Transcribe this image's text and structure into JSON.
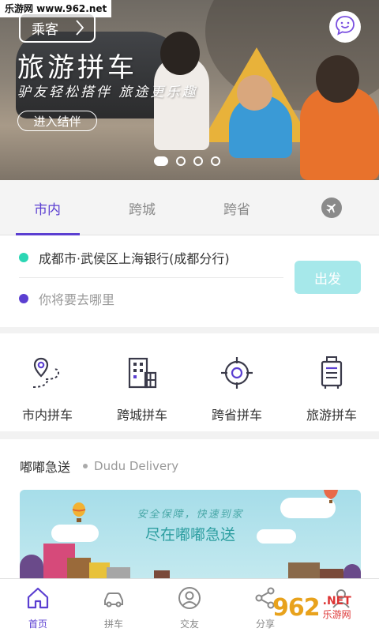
{
  "watermark_top": "乐游网 www.962.net",
  "banner": {
    "role_button": "乘客",
    "title": "旅游拼车",
    "subtitle": "驴友轻松搭伴 旅途更乐趣",
    "join_button": "进入结伴",
    "slide_count": 4,
    "active_slide": 1
  },
  "tabs": [
    {
      "label": "市内",
      "active": true
    },
    {
      "label": "跨城",
      "active": false
    },
    {
      "label": "跨省",
      "active": false
    },
    {
      "icon": "airplane-icon",
      "active": false
    }
  ],
  "address": {
    "from": "成都市·武侯区上海银行(成都分行)",
    "to_placeholder": "你将要去哪里",
    "go_button": "出发",
    "from_color": "#2bd6b4",
    "to_color": "#5b3fd1"
  },
  "services": [
    {
      "label": "市内拼车",
      "icon": "map-pin-route-icon"
    },
    {
      "label": "跨城拼车",
      "icon": "building-icon"
    },
    {
      "label": "跨省拼车",
      "icon": "target-icon"
    },
    {
      "label": "旅游拼车",
      "icon": "luggage-icon"
    }
  ],
  "delivery": {
    "title": "嘟嘟急送",
    "subtitle": "Dudu Delivery",
    "slogan": "安全保障，快速到家",
    "headline": "尽在嘟嘟急送"
  },
  "bottom_nav": [
    {
      "label": "首页",
      "icon": "home-icon",
      "active": true
    },
    {
      "label": "拼车",
      "icon": "car-icon",
      "active": false
    },
    {
      "label": "交友",
      "icon": "friends-icon",
      "active": false
    },
    {
      "label": "分享",
      "icon": "share-icon",
      "active": false
    },
    {
      "label": "",
      "icon": "profile-icon",
      "active": false
    }
  ],
  "watermark_bottom": {
    "logo": "962",
    "net": ".NET",
    "cn": "乐游网"
  },
  "colors": {
    "accent": "#5b3fd1",
    "go_button": "#a6e8ea",
    "delivery_text": "#2d9ea0"
  }
}
